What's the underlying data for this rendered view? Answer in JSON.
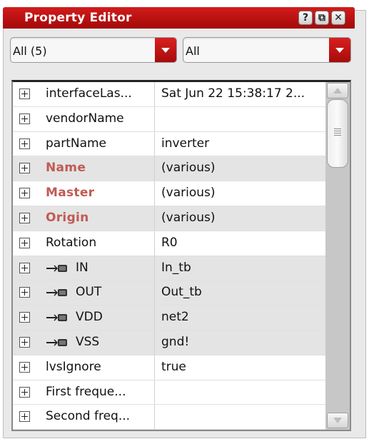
{
  "window": {
    "title": "Property Editor",
    "buttons": {
      "help": "?",
      "float": "⧉",
      "close": "✕"
    }
  },
  "filters": {
    "left_combo": {
      "value": "All (5)"
    },
    "right_combo": {
      "value": "All"
    }
  },
  "properties": [
    {
      "name": "interfaceLas...",
      "value": "Sat Jun 22 15:38:17 2...",
      "style": "normal",
      "pin": false,
      "shaded": false
    },
    {
      "name": "vendorName",
      "value": "",
      "style": "normal",
      "pin": false,
      "shaded": false
    },
    {
      "name": "partName",
      "value": "inverter",
      "style": "normal",
      "pin": false,
      "shaded": false
    },
    {
      "name": "Name",
      "value": "(various)",
      "style": "bold",
      "pin": false,
      "shaded": true
    },
    {
      "name": "Master",
      "value": "(various)",
      "style": "bold",
      "pin": false,
      "shaded": false
    },
    {
      "name": "Origin",
      "value": "(various)",
      "style": "bold",
      "pin": false,
      "shaded": true
    },
    {
      "name": "Rotation",
      "value": "R0",
      "style": "normal",
      "pin": false,
      "shaded": false
    },
    {
      "name": "IN",
      "value": "In_tb",
      "style": "normal",
      "pin": true,
      "shaded": true
    },
    {
      "name": "OUT",
      "value": "Out_tb",
      "style": "normal",
      "pin": true,
      "shaded": true
    },
    {
      "name": "VDD",
      "value": "net2",
      "style": "normal",
      "pin": true,
      "shaded": true
    },
    {
      "name": "VSS",
      "value": "gnd!",
      "style": "normal",
      "pin": true,
      "shaded": true
    },
    {
      "name": "lvsIgnore",
      "value": "true",
      "style": "normal",
      "pin": false,
      "shaded": false
    },
    {
      "name": "First freque...",
      "value": "",
      "style": "normal",
      "pin": false,
      "shaded": false
    },
    {
      "name": "Second freq...",
      "value": "",
      "style": "normal",
      "pin": false,
      "shaded": false
    }
  ],
  "icons": {
    "expander": "plus-box-icon",
    "pin": "terminal-pin-icon"
  },
  "colors": {
    "title_bar": "#b81010",
    "accent_red": "#c81616",
    "bold_property": "#c15a54",
    "shaded_row": "#e4e4e4"
  }
}
